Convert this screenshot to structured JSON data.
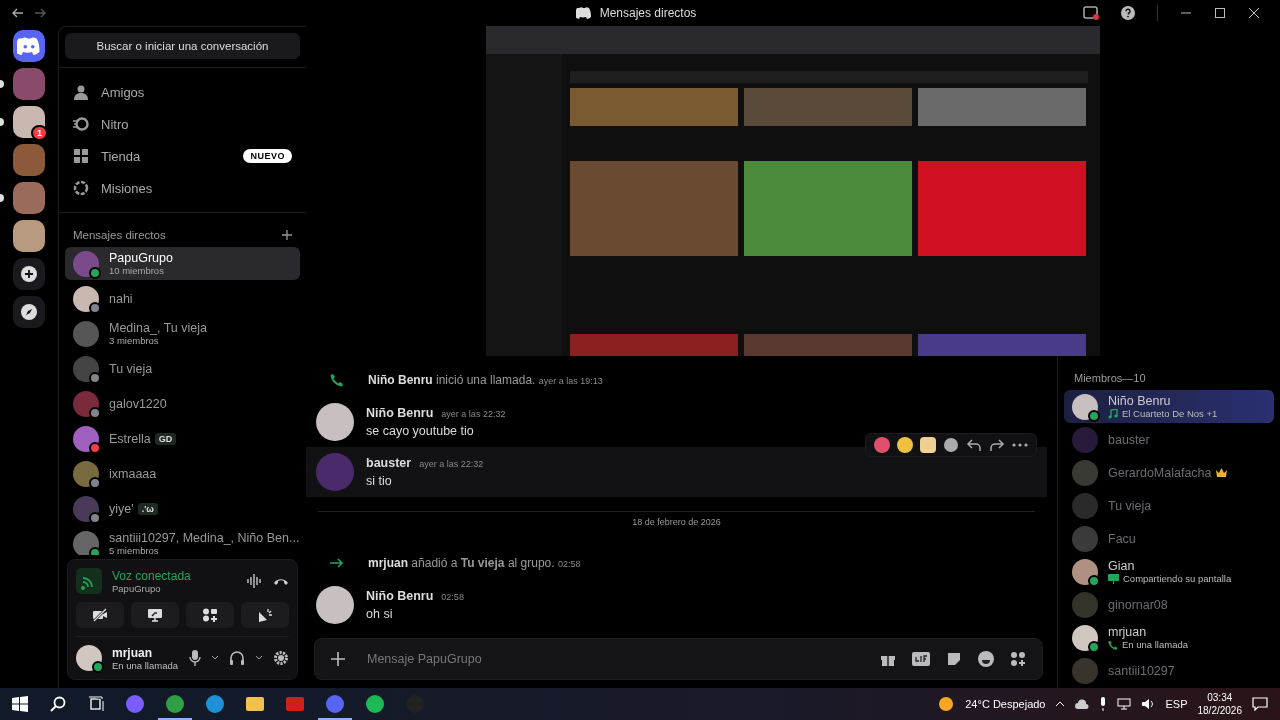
{
  "window": {
    "title": "Mensajes directos"
  },
  "servers": [
    {
      "kind": "home",
      "color": "#5865f2",
      "unread": false
    },
    {
      "kind": "avatar",
      "color": "#8a4a6a",
      "unread": true
    },
    {
      "kind": "avatar",
      "color": "#c9b8b0",
      "unread": true,
      "badge": "1"
    },
    {
      "kind": "avatar",
      "color": "#8a5a3a",
      "unread": false
    },
    {
      "kind": "avatar",
      "color": "#9a6a5a",
      "unread": true
    },
    {
      "kind": "avatar",
      "color": "#b89a80",
      "unread": false
    },
    {
      "kind": "add"
    },
    {
      "kind": "explore"
    }
  ],
  "search": {
    "label": "Buscar o iniciar una conversación"
  },
  "nav": [
    {
      "kind": "friends",
      "label": "Amigos"
    },
    {
      "kind": "nitro",
      "label": "Nitro"
    },
    {
      "kind": "shop",
      "label": "Tienda",
      "badge": "NUEVO"
    },
    {
      "kind": "quests",
      "label": "Misiones"
    }
  ],
  "dm_header": "Mensajes directos",
  "dms": [
    {
      "name": "PapuGrupo",
      "subtitle": "10 miembros",
      "selected": true,
      "status": {
        "color": "#23a55a"
      },
      "color": "#7a4a8a"
    },
    {
      "name": "nahi",
      "selected": false,
      "status": {
        "color": "#80848e"
      },
      "color": "#c9b8b0"
    },
    {
      "name": "Medina_, Tu vieja",
      "subtitle": "3 miembros",
      "selected": false,
      "color": "#555555"
    },
    {
      "name": "Tu vieja",
      "selected": false,
      "status": {
        "color": "#80848e"
      },
      "color": "#444444"
    },
    {
      "name": "galov1220",
      "selected": false,
      "status": {
        "color": "#80848e"
      },
      "color": "#7a2a3a"
    },
    {
      "name": "Estrella",
      "selected": false,
      "status": {
        "color": "#f23f43"
      },
      "tag": "GD",
      "color": "#a060c0"
    },
    {
      "name": "ixmaaaa",
      "selected": false,
      "status": {
        "color": "#80848e"
      },
      "color": "#7a6a40"
    },
    {
      "name": "yiye'",
      "selected": false,
      "status": {
        "color": "#80848e"
      },
      "tag": ".'ω",
      "color": "#4a3a5a"
    },
    {
      "name": "santiii10297, Medina_, Niño Ben...",
      "subtitle": "5 miembros",
      "selected": false,
      "status": {
        "color": "#23a55a"
      },
      "color": "#666666"
    }
  ],
  "voice": {
    "status": "Voz conectada",
    "channel": "PapuGrupo"
  },
  "user": {
    "name": "mrjuan",
    "status": "En una llamada"
  },
  "messages": [
    {
      "kind": "call",
      "author": "Niño Benru",
      "text": "inició una llamada.",
      "time": "ayer a las 19:13"
    },
    {
      "kind": "message",
      "author": "Niño Benru",
      "text": "se cayo youtube tio",
      "time": "ayer a las 22:32",
      "color": "#c8c0c0",
      "hovered": false
    },
    {
      "kind": "message",
      "author": "bauster",
      "text": "si tio",
      "time": "ayer a las 22:32",
      "color": "#4a2a6a",
      "hovered": true
    },
    {
      "kind": "divider",
      "text": "18 de febrero de 2026"
    },
    {
      "kind": "added",
      "author": "mrjuan",
      "text": "añadió a **Tu vieja** al grupo.",
      "time": "02:58"
    },
    {
      "kind": "message",
      "author": "Niño Benru",
      "text": "oh si",
      "time": "02:58",
      "color": "#c8c0c0",
      "hovered": false
    }
  ],
  "composer": {
    "placeholder": "Mensaje PapuGrupo"
  },
  "members_header": "Miembros—10",
  "members": [
    {
      "name": "Niño Benru",
      "activity": {
        "kind": "music",
        "text": "El Cuarteto De Nos +1"
      },
      "online": true,
      "color": "#c8c0c0",
      "crown": false,
      "boosted": true
    },
    {
      "name": "bauster",
      "online": false,
      "color": "#2a1a3a",
      "crown": false,
      "boosted": false
    },
    {
      "name": "GerardoMalafacha",
      "online": false,
      "color": "#3a3a34",
      "crown": true,
      "boosted": false
    },
    {
      "name": "Tu vieja",
      "online": false,
      "color": "#2a2a2a",
      "crown": false,
      "boosted": false
    },
    {
      "name": "Facu",
      "online": false,
      "color": "#3a3a3a",
      "crown": false,
      "boosted": false
    },
    {
      "name": "Gian",
      "activity": {
        "kind": "screen",
        "text": "Compartiendo su pantalla"
      },
      "online": true,
      "color": "#b09080",
      "crown": false,
      "boosted": false
    },
    {
      "name": "ginornar08",
      "online": false,
      "color": "#33332a",
      "crown": false,
      "boosted": false
    },
    {
      "name": "mrjuan",
      "activity": {
        "kind": "call",
        "text": "En una llamada"
      },
      "online": true,
      "color": "#d0c8c0",
      "crown": false,
      "boosted": false
    },
    {
      "name": "santiii10297",
      "online": false,
      "color": "#38342c",
      "crown": false,
      "boosted": false
    }
  ],
  "taskbar": {
    "apps": [
      {
        "kind": "copilot",
        "active": false
      },
      {
        "kind": "chrome",
        "active": true
      },
      {
        "kind": "edge",
        "active": false
      },
      {
        "kind": "folder",
        "active": false
      },
      {
        "kind": "pdf",
        "active": false
      },
      {
        "kind": "discord",
        "active": true
      },
      {
        "kind": "spotify",
        "active": false
      },
      {
        "kind": "obs",
        "active": false
      }
    ],
    "weather": "24°C Despejado",
    "lang": "ESP",
    "time": "03:34",
    "date": "18/2/2026"
  }
}
